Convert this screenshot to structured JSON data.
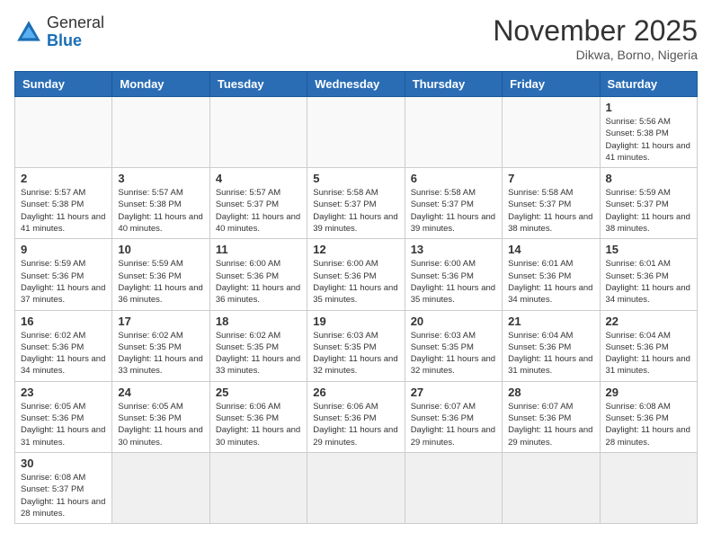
{
  "logo": {
    "general": "General",
    "blue": "Blue"
  },
  "title": "November 2025",
  "location": "Dikwa, Borno, Nigeria",
  "weekdays": [
    "Sunday",
    "Monday",
    "Tuesday",
    "Wednesday",
    "Thursday",
    "Friday",
    "Saturday"
  ],
  "weeks": [
    [
      {
        "day": "",
        "info": ""
      },
      {
        "day": "",
        "info": ""
      },
      {
        "day": "",
        "info": ""
      },
      {
        "day": "",
        "info": ""
      },
      {
        "day": "",
        "info": ""
      },
      {
        "day": "",
        "info": ""
      },
      {
        "day": "1",
        "info": "Sunrise: 5:56 AM\nSunset: 5:38 PM\nDaylight: 11 hours\nand 41 minutes."
      }
    ],
    [
      {
        "day": "2",
        "info": "Sunrise: 5:57 AM\nSunset: 5:38 PM\nDaylight: 11 hours\nand 41 minutes."
      },
      {
        "day": "3",
        "info": "Sunrise: 5:57 AM\nSunset: 5:38 PM\nDaylight: 11 hours\nand 40 minutes."
      },
      {
        "day": "4",
        "info": "Sunrise: 5:57 AM\nSunset: 5:37 PM\nDaylight: 11 hours\nand 40 minutes."
      },
      {
        "day": "5",
        "info": "Sunrise: 5:58 AM\nSunset: 5:37 PM\nDaylight: 11 hours\nand 39 minutes."
      },
      {
        "day": "6",
        "info": "Sunrise: 5:58 AM\nSunset: 5:37 PM\nDaylight: 11 hours\nand 39 minutes."
      },
      {
        "day": "7",
        "info": "Sunrise: 5:58 AM\nSunset: 5:37 PM\nDaylight: 11 hours\nand 38 minutes."
      },
      {
        "day": "8",
        "info": "Sunrise: 5:59 AM\nSunset: 5:37 PM\nDaylight: 11 hours\nand 38 minutes."
      }
    ],
    [
      {
        "day": "9",
        "info": "Sunrise: 5:59 AM\nSunset: 5:36 PM\nDaylight: 11 hours\nand 37 minutes."
      },
      {
        "day": "10",
        "info": "Sunrise: 5:59 AM\nSunset: 5:36 PM\nDaylight: 11 hours\nand 36 minutes."
      },
      {
        "day": "11",
        "info": "Sunrise: 6:00 AM\nSunset: 5:36 PM\nDaylight: 11 hours\nand 36 minutes."
      },
      {
        "day": "12",
        "info": "Sunrise: 6:00 AM\nSunset: 5:36 PM\nDaylight: 11 hours\nand 35 minutes."
      },
      {
        "day": "13",
        "info": "Sunrise: 6:00 AM\nSunset: 5:36 PM\nDaylight: 11 hours\nand 35 minutes."
      },
      {
        "day": "14",
        "info": "Sunrise: 6:01 AM\nSunset: 5:36 PM\nDaylight: 11 hours\nand 34 minutes."
      },
      {
        "day": "15",
        "info": "Sunrise: 6:01 AM\nSunset: 5:36 PM\nDaylight: 11 hours\nand 34 minutes."
      }
    ],
    [
      {
        "day": "16",
        "info": "Sunrise: 6:02 AM\nSunset: 5:36 PM\nDaylight: 11 hours\nand 34 minutes."
      },
      {
        "day": "17",
        "info": "Sunrise: 6:02 AM\nSunset: 5:35 PM\nDaylight: 11 hours\nand 33 minutes."
      },
      {
        "day": "18",
        "info": "Sunrise: 6:02 AM\nSunset: 5:35 PM\nDaylight: 11 hours\nand 33 minutes."
      },
      {
        "day": "19",
        "info": "Sunrise: 6:03 AM\nSunset: 5:35 PM\nDaylight: 11 hours\nand 32 minutes."
      },
      {
        "day": "20",
        "info": "Sunrise: 6:03 AM\nSunset: 5:35 PM\nDaylight: 11 hours\nand 32 minutes."
      },
      {
        "day": "21",
        "info": "Sunrise: 6:04 AM\nSunset: 5:36 PM\nDaylight: 11 hours\nand 31 minutes."
      },
      {
        "day": "22",
        "info": "Sunrise: 6:04 AM\nSunset: 5:36 PM\nDaylight: 11 hours\nand 31 minutes."
      }
    ],
    [
      {
        "day": "23",
        "info": "Sunrise: 6:05 AM\nSunset: 5:36 PM\nDaylight: 11 hours\nand 31 minutes."
      },
      {
        "day": "24",
        "info": "Sunrise: 6:05 AM\nSunset: 5:36 PM\nDaylight: 11 hours\nand 30 minutes."
      },
      {
        "day": "25",
        "info": "Sunrise: 6:06 AM\nSunset: 5:36 PM\nDaylight: 11 hours\nand 30 minutes."
      },
      {
        "day": "26",
        "info": "Sunrise: 6:06 AM\nSunset: 5:36 PM\nDaylight: 11 hours\nand 29 minutes."
      },
      {
        "day": "27",
        "info": "Sunrise: 6:07 AM\nSunset: 5:36 PM\nDaylight: 11 hours\nand 29 minutes."
      },
      {
        "day": "28",
        "info": "Sunrise: 6:07 AM\nSunset: 5:36 PM\nDaylight: 11 hours\nand 29 minutes."
      },
      {
        "day": "29",
        "info": "Sunrise: 6:08 AM\nSunset: 5:36 PM\nDaylight: 11 hours\nand 28 minutes."
      }
    ],
    [
      {
        "day": "30",
        "info": "Sunrise: 6:08 AM\nSunset: 5:37 PM\nDaylight: 11 hours\nand 28 minutes."
      },
      {
        "day": "",
        "info": ""
      },
      {
        "day": "",
        "info": ""
      },
      {
        "day": "",
        "info": ""
      },
      {
        "day": "",
        "info": ""
      },
      {
        "day": "",
        "info": ""
      },
      {
        "day": "",
        "info": ""
      }
    ]
  ]
}
